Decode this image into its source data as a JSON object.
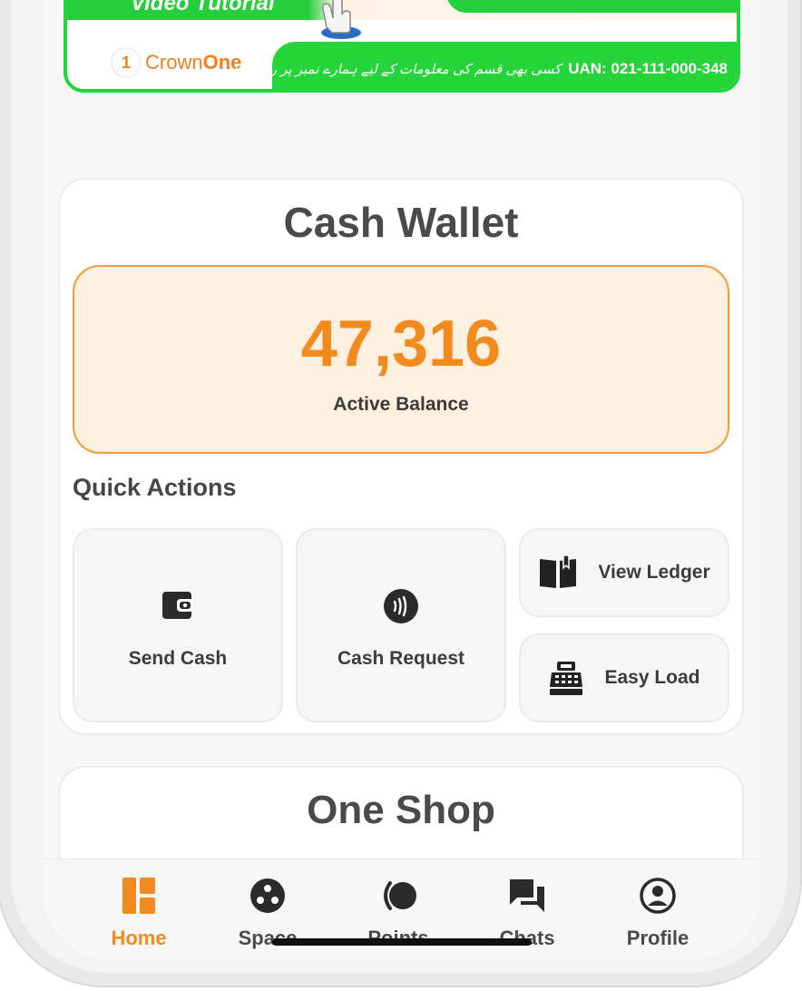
{
  "banner": {
    "title": "Video Tutorial",
    "brand_prefix": "Crown",
    "brand_suffix": "One",
    "uan": "UAN: 021-111-000-348",
    "urdu_text": "کسی بھی قسم کی معلومات کے لیے ہمارے نمبر پر رابطہ کریں۔"
  },
  "wallet": {
    "title": "Cash Wallet",
    "balance": "47,316",
    "balance_label": "Active Balance",
    "quick_actions_title": "Quick Actions",
    "actions": {
      "send_cash": "Send Cash",
      "cash_request": "Cash Request",
      "view_ledger": "View Ledger",
      "easy_load": "Easy Load"
    }
  },
  "shop": {
    "title": "One Shop"
  },
  "nav": {
    "items": [
      {
        "label": "Home",
        "icon": "dashboard-icon"
      },
      {
        "label": "Space",
        "icon": "space-icon"
      },
      {
        "label": "Points",
        "icon": "points-icon"
      },
      {
        "label": "Chats",
        "icon": "chats-icon"
      },
      {
        "label": "Profile",
        "icon": "profile-icon"
      }
    ],
    "active_color": "#f28a1e",
    "inactive_color": "#4a4a4a"
  },
  "colors": {
    "accent": "#f28a1e",
    "banner_green": "#24d439",
    "balance_bg": "#fff0e0"
  }
}
